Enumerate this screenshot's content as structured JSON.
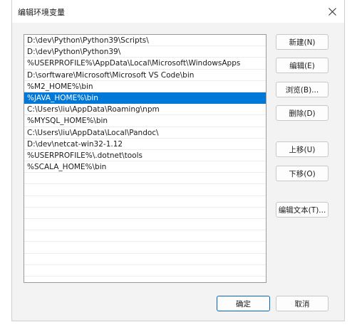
{
  "window": {
    "title": "编辑环境变量"
  },
  "list": {
    "items": [
      "D:\\dev\\Python\\Python39\\Scripts\\",
      "D:\\dev\\Python\\Python39\\",
      "%USERPROFILE%\\AppData\\Local\\Microsoft\\WindowsApps",
      "D:\\sorftware\\Microsoft\\Microsoft VS Code\\bin",
      "%M2_HOME%\\bin",
      "%JAVA_HOME%\\bin",
      "C:\\Users\\liu\\AppData\\Roaming\\npm",
      "%MYSQL_HOME%\\bin",
      "C:\\Users\\liu\\AppData\\Local\\Pandoc\\",
      "D:\\dev\\netcat-win32-1.12",
      "%USERPROFILE%\\.dotnet\\tools",
      "%SCALA_HOME%\\bin"
    ],
    "selected_index": 5,
    "visible_rows": 21
  },
  "buttons": {
    "new": "新建(N)",
    "edit": "编辑(E)",
    "browse": "浏览(B)...",
    "delete": "删除(D)",
    "move_up": "上移(U)",
    "move_down": "下移(O)",
    "edit_text": "编辑文本(T)...",
    "ok": "确定",
    "cancel": "取消"
  },
  "colors": {
    "selection": "#0078d7",
    "primary_border": "#0067c0"
  },
  "icons": {
    "close": "close-icon"
  }
}
